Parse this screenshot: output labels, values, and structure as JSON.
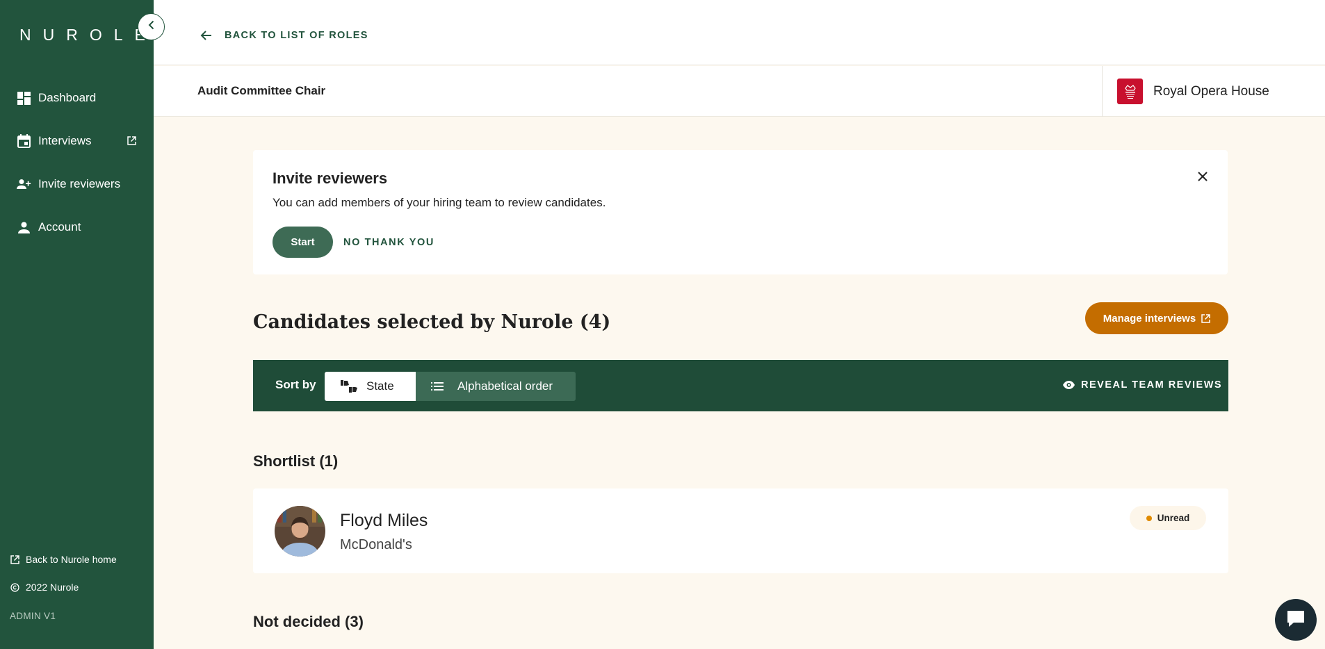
{
  "brand": {
    "logo_text": "NUROLE"
  },
  "sidebar": {
    "items": [
      {
        "label": "Dashboard",
        "icon": "dashboard-icon"
      },
      {
        "label": "Interviews",
        "icon": "calendar-icon",
        "external": true
      },
      {
        "label": "Invite reviewers",
        "icon": "add-user-icon"
      },
      {
        "label": "Account",
        "icon": "person-icon"
      }
    ],
    "footer": {
      "back_home": "Back to Nurole home",
      "copyright": "2022 Nurole",
      "version": "ADMIN V1"
    }
  },
  "header": {
    "back_label": "BACK TO LIST OF ROLES",
    "role_title": "Audit Committee Chair",
    "org_name": "Royal Opera House"
  },
  "invite": {
    "title": "Invite reviewers",
    "text": "You can add members of your hiring team to review candidates.",
    "start_label": "Start",
    "decline_label": "NO THANK YOU"
  },
  "candidates": {
    "title": "Candidates selected by Nurole (4)",
    "manage_label": "Manage interviews"
  },
  "sort": {
    "label": "Sort by",
    "options": [
      "State",
      "Alphabetical order"
    ],
    "selected": "State",
    "reveal_label": "REVEAL TEAM REVIEWS"
  },
  "sections": {
    "shortlist_title": "Shortlist (1)",
    "not_decided_title": "Not decided (3)"
  },
  "shortlist": [
    {
      "name": "Floyd Miles",
      "company": "McDonald's",
      "status": "Unread"
    }
  ],
  "colors": {
    "sidebar": "#22543d",
    "accent_orange": "#c46d00",
    "background": "#fdf8ef",
    "org_logo": "#c8102e"
  }
}
